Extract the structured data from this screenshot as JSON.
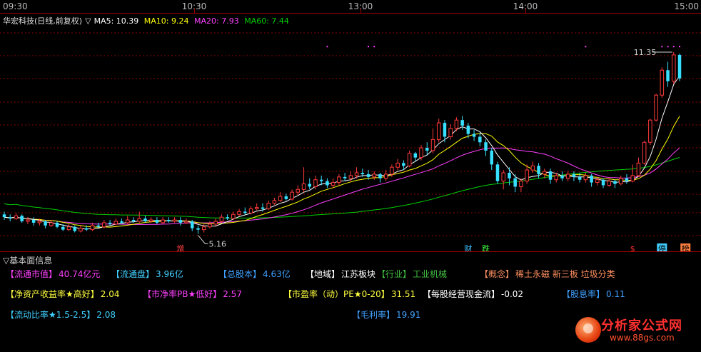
{
  "time_axis": [
    "09:30",
    "10:30",
    "13:00",
    "14:00",
    "15:00"
  ],
  "header": {
    "stock": "华宏科技(日线,前复权)",
    "arrow": "▽",
    "ma5": "MA5: 10.39",
    "ma10": "MA10: 9.24",
    "ma20": "MA20: 7.93",
    "ma60": "MA60: 7.44"
  },
  "colors": {
    "up": "#ff3a3a",
    "down": "#38e0ff",
    "ma5": "#ffffff",
    "ma10": "#ffff00",
    "ma20": "#ff40ff",
    "ma60": "#00d000",
    "grid": "#8a0000"
  },
  "chart_data": {
    "type": "candlestick",
    "ylim": [
      4.4,
      12.2
    ],
    "high_label": "11.35",
    "low_label": "5.16",
    "candles": [
      [
        5.5,
        5.4,
        5.6,
        5.3
      ],
      [
        5.4,
        5.35,
        5.5,
        5.25
      ],
      [
        5.35,
        5.45,
        5.55,
        5.3
      ],
      [
        5.45,
        5.25,
        5.5,
        5.2
      ],
      [
        5.25,
        5.3,
        5.4,
        5.15
      ],
      [
        5.3,
        5.2,
        5.4,
        5.1
      ],
      [
        5.2,
        5.25,
        5.35,
        5.1
      ],
      [
        5.25,
        5.1,
        5.3,
        5.0
      ],
      [
        5.1,
        5.2,
        5.3,
        5.05
      ],
      [
        5.2,
        5.05,
        5.25,
        5.0
      ],
      [
        5.05,
        4.95,
        5.15,
        4.9
      ],
      [
        4.95,
        5.05,
        5.15,
        4.9
      ],
      [
        5.05,
        4.9,
        5.1,
        4.85
      ],
      [
        4.9,
        5.0,
        5.1,
        4.85
      ],
      [
        5.0,
        4.95,
        5.1,
        4.9
      ],
      [
        4.95,
        5.1,
        5.2,
        4.9
      ],
      [
        5.1,
        5.05,
        5.2,
        5.0
      ],
      [
        5.05,
        5.2,
        5.3,
        5.0
      ],
      [
        5.2,
        5.15,
        5.3,
        5.1
      ],
      [
        5.15,
        5.25,
        5.35,
        5.1
      ],
      [
        5.25,
        5.2,
        5.35,
        5.15
      ],
      [
        5.2,
        5.3,
        5.45,
        5.15
      ],
      [
        5.3,
        5.25,
        5.4,
        5.2
      ],
      [
        5.25,
        5.35,
        5.6,
        5.2
      ],
      [
        5.35,
        5.25,
        5.45,
        5.2
      ],
      [
        5.25,
        5.3,
        5.4,
        5.2
      ],
      [
        5.3,
        5.2,
        5.4,
        5.15
      ],
      [
        5.2,
        5.3,
        5.4,
        5.15
      ],
      [
        5.3,
        5.25,
        5.4,
        5.2
      ],
      [
        5.25,
        5.3,
        5.4,
        5.2
      ],
      [
        5.3,
        5.2,
        5.4,
        5.1
      ],
      [
        5.2,
        5.25,
        5.35,
        5.15
      ],
      [
        5.25,
        5.0,
        5.3,
        4.9
      ],
      [
        5.0,
        4.95,
        5.1,
        4.8
      ],
      [
        4.95,
        5.05,
        5.15,
        4.85
      ],
      [
        5.05,
        5.15,
        5.25,
        5.0
      ],
      [
        5.15,
        5.25,
        5.35,
        5.1
      ],
      [
        5.25,
        5.4,
        5.5,
        5.2
      ],
      [
        5.4,
        5.35,
        5.5,
        5.3
      ],
      [
        5.35,
        5.5,
        5.6,
        5.3
      ],
      [
        5.5,
        5.6,
        5.7,
        5.45
      ],
      [
        5.6,
        5.55,
        5.75,
        5.5
      ],
      [
        5.55,
        5.7,
        5.8,
        5.5
      ],
      [
        5.7,
        5.75,
        5.9,
        5.65
      ],
      [
        5.75,
        5.7,
        5.9,
        5.6
      ],
      [
        5.7,
        5.9,
        6.0,
        5.65
      ],
      [
        5.9,
        6.0,
        6.1,
        5.85
      ],
      [
        6.0,
        6.15,
        6.3,
        5.95
      ],
      [
        6.15,
        6.05,
        6.25,
        6.0
      ],
      [
        6.05,
        6.3,
        6.4,
        6.0
      ],
      [
        6.3,
        6.4,
        6.55,
        6.2
      ],
      [
        6.4,
        6.6,
        7.2,
        6.3
      ],
      [
        6.6,
        6.5,
        6.8,
        6.4
      ],
      [
        6.5,
        6.75,
        6.9,
        6.4
      ],
      [
        6.75,
        6.7,
        6.9,
        6.55
      ],
      [
        6.7,
        6.55,
        6.8,
        6.45
      ],
      [
        6.55,
        6.65,
        6.8,
        6.45
      ],
      [
        6.65,
        6.85,
        6.95,
        6.55
      ],
      [
        6.85,
        6.8,
        7.0,
        6.7
      ],
      [
        6.8,
        6.9,
        7.05,
        6.7
      ],
      [
        6.9,
        7.0,
        7.2,
        6.8
      ],
      [
        7.0,
        6.95,
        7.15,
        6.85
      ],
      [
        6.95,
        6.85,
        7.1,
        6.75
      ],
      [
        6.85,
        6.95,
        7.05,
        6.75
      ],
      [
        6.95,
        6.8,
        7.0,
        6.65
      ],
      [
        6.8,
        6.95,
        7.1,
        6.7
      ],
      [
        6.95,
        7.2,
        7.3,
        6.85
      ],
      [
        7.2,
        7.35,
        7.5,
        7.1
      ],
      [
        7.35,
        7.25,
        7.45,
        7.1
      ],
      [
        7.25,
        7.7,
        7.8,
        7.2
      ],
      [
        7.7,
        7.55,
        7.75,
        7.4
      ],
      [
        7.55,
        7.9,
        8.0,
        7.45
      ],
      [
        7.9,
        7.8,
        8.1,
        7.65
      ],
      [
        7.8,
        8.2,
        8.6,
        7.7
      ],
      [
        8.2,
        8.8,
        8.95,
        8.1
      ],
      [
        8.8,
        8.3,
        8.9,
        8.1
      ],
      [
        8.3,
        8.6,
        8.75,
        8.2
      ],
      [
        8.6,
        8.9,
        9.0,
        8.5
      ],
      [
        8.9,
        8.7,
        9.05,
        8.55
      ],
      [
        8.7,
        8.4,
        8.8,
        8.25
      ],
      [
        8.4,
        8.3,
        8.55,
        8.15
      ],
      [
        8.3,
        8.1,
        8.45,
        7.95
      ],
      [
        8.1,
        7.8,
        8.2,
        7.6
      ],
      [
        7.8,
        7.3,
        7.9,
        7.1
      ],
      [
        7.3,
        6.7,
        7.4,
        6.6
      ],
      [
        6.7,
        7.0,
        7.1,
        6.4
      ],
      [
        7.0,
        6.8,
        7.2,
        6.55
      ],
      [
        6.8,
        6.5,
        6.95,
        6.3
      ],
      [
        6.5,
        6.7,
        6.8,
        6.3
      ],
      [
        6.7,
        7.1,
        7.3,
        6.6
      ],
      [
        7.1,
        7.25,
        7.4,
        7.0
      ],
      [
        7.25,
        6.95,
        7.35,
        6.8
      ],
      [
        6.95,
        7.05,
        7.15,
        6.8
      ],
      [
        7.05,
        6.75,
        7.15,
        6.6
      ],
      [
        6.75,
        6.9,
        7.0,
        6.65
      ],
      [
        6.9,
        6.8,
        7.05,
        6.7
      ],
      [
        6.8,
        6.95,
        7.05,
        6.7
      ],
      [
        6.95,
        6.85,
        7.05,
        6.7
      ],
      [
        6.85,
        6.75,
        7.0,
        6.65
      ],
      [
        6.75,
        6.9,
        7.0,
        6.65
      ],
      [
        6.9,
        6.65,
        6.95,
        6.5
      ],
      [
        6.65,
        6.75,
        6.85,
        6.55
      ],
      [
        6.75,
        6.55,
        6.8,
        6.45
      ],
      [
        6.55,
        6.7,
        6.8,
        6.5
      ],
      [
        6.7,
        6.6,
        6.75,
        6.45
      ],
      [
        6.6,
        6.8,
        6.9,
        6.55
      ],
      [
        6.8,
        6.7,
        6.95,
        6.6
      ],
      [
        6.7,
        6.9,
        7.3,
        6.65
      ],
      [
        6.9,
        7.35,
        7.55,
        6.85
      ],
      [
        7.35,
        8.1,
        8.15,
        7.3
      ],
      [
        8.1,
        8.9,
        8.95,
        8.0
      ],
      [
        8.9,
        9.8,
        9.85,
        8.85
      ],
      [
        9.8,
        10.7,
        10.8,
        9.7
      ],
      [
        10.7,
        10.3,
        11.0,
        10.1
      ],
      [
        10.3,
        11.25,
        11.35,
        10.2
      ],
      [
        11.25,
        10.4,
        11.3,
        10.3
      ]
    ],
    "markers": [
      {
        "index": 55,
        "price": 11.55
      },
      {
        "index": 62,
        "price": 11.55
      },
      {
        "index": 63,
        "price": 11.55
      },
      {
        "index": 99,
        "price": 11.55
      },
      {
        "index": 112,
        "price": 11.55
      },
      {
        "index": 113,
        "price": 11.55
      },
      {
        "index": 114,
        "price": 11.55
      },
      {
        "index": 115,
        "price": 11.55
      }
    ],
    "series": [
      {
        "key": "ma5"
      },
      {
        "key": "ma10"
      },
      {
        "key": "ma20"
      },
      {
        "key": "ma60"
      }
    ],
    "tags": [
      {
        "index": 30,
        "text": "增",
        "color": "#ff4040",
        "bg": ""
      },
      {
        "index": 79,
        "text": "财",
        "color": "#40c0ff",
        "bg": ""
      },
      {
        "index": 82,
        "text": "跌",
        "color": "#40ff40",
        "bg": ""
      },
      {
        "index": 107,
        "text": "$",
        "color": "#ff3030",
        "bg": ""
      },
      {
        "index": 112,
        "text": "停",
        "color": "#000000",
        "bg": "#40d0ff"
      },
      {
        "index": 116,
        "text": "榜",
        "color": "#000000",
        "bg": "#ff8040"
      }
    ]
  },
  "fundamentals": {
    "title": "▽基本面信息",
    "rows": [
      [
        {
          "label": "【流通市值】",
          "value": "40.74亿元",
          "color": "#ff40ff"
        },
        {
          "label": "【流通盘】",
          "value": "3.96亿",
          "color": "#40d0ff"
        },
        {
          "label": "【总股本】",
          "value": "4.63亿",
          "color": "#40a0ff"
        },
        {
          "label": "【地域】",
          "value": "江苏板块",
          "color": "#ffffff"
        },
        {
          "label": "【行业】",
          "value": "工业机械",
          "color": "#40c040"
        },
        {
          "label": "【概念】",
          "value": "稀土永磁 新三板 垃圾分类",
          "color": "#ff9060"
        }
      ],
      [
        {
          "label": "【净资产收益率★高好】",
          "value": "2.04",
          "color": "#ffff40"
        },
        {
          "label": "【市净率PB★低好】",
          "value": "2.57",
          "color": "#ff40ff"
        },
        {
          "label": "【市盈率（动）PE★0-20】",
          "value": "31.51",
          "color": "#ffff40"
        },
        {
          "label": "【每股经营现金流】",
          "value": "-0.02",
          "color": "#ffffff"
        },
        {
          "label": "【股息率】",
          "value": "0.11",
          "color": "#40a0ff"
        }
      ],
      [
        {
          "label": "【流动比率★1.5-2.5】",
          "value": "2.08",
          "color": "#40d0ff"
        },
        {
          "label": "【毛利率】",
          "value": "19.91",
          "color": "#40a0ff"
        }
      ]
    ]
  },
  "watermark": {
    "title": "分析家公式网",
    "url": "www.88gs.com"
  }
}
